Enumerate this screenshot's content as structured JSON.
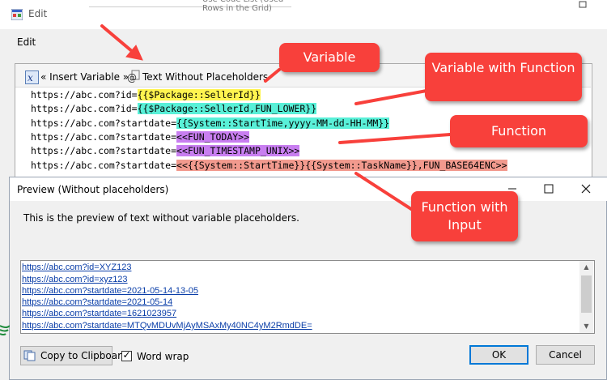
{
  "edit_window": {
    "title": "Edit",
    "label": "Edit",
    "background_title": "Use Code List (Used Rows in the Grid)"
  },
  "toolbar": {
    "insert_variable": "« Insert Variable »",
    "text_without_placeholders": "Text Without Placeholders"
  },
  "editor_lines": [
    {
      "prefix": "https://abc.com?id=",
      "highlight": "{{$Package::SellerId}}",
      "color": "#fff44f"
    },
    {
      "prefix": "https://abc.com?id=",
      "highlight": "{{$Package::SellerId,FUN_LOWER}}",
      "color": "#59f0d8"
    },
    {
      "prefix": "https://abc.com?startdate=",
      "highlight": "{{System::StartTime,yyyy-MM-dd-HH-MM}}",
      "color": "#59f0d8"
    },
    {
      "prefix": "https://abc.com?startdate=",
      "highlight": "<<FUN_TODAY>>",
      "color": "#c87ef0"
    },
    {
      "prefix": "https://abc.com?startdate=",
      "highlight": "<<FUN_TIMESTAMP_UNIX>>",
      "color": "#c87ef0"
    },
    {
      "prefix": "https://abc.com?startdate=",
      "highlight": "<<{{System::StartTime}}{{System::TaskName}},FUN_BASE64ENC>>",
      "color": "#f29a8e"
    }
  ],
  "preview": {
    "title": "Preview (Without placeholders)",
    "description": "This is the preview of text without variable placeholders.",
    "lines": [
      "https://abc.com?id=XYZ123",
      "https://abc.com?id=xyz123",
      "https://abc.com?startdate=2021-05-14-13-05",
      "https://abc.com?startdate=2021-05-14",
      "https://abc.com?startdate=1621023957",
      "https://abc.com?startdate=MTQvMDUvMjAyMSAxMy40NC4yM2RmdDE="
    ],
    "copy_button": "Copy to Clipboard",
    "word_wrap_label": "Word wrap",
    "word_wrap_checked": "✓",
    "ok_button": "OK",
    "cancel_button": "Cancel"
  },
  "callouts": {
    "variable": "Variable",
    "variable_with_function": "Variable with Function",
    "function": "Function",
    "function_with_input": "Function with Input"
  },
  "colors": {
    "callout": "#f8403b",
    "variable_highlight": "#fff44f",
    "function_var_highlight": "#59f0d8",
    "function_highlight": "#c87ef0",
    "function_input_highlight": "#f29a8e",
    "link": "#0a3ea8"
  },
  "icons": {
    "window_icon": "app-window-icon",
    "insert_variable": "insert-variable-icon",
    "text_without_placeholders": "at-document-icon",
    "copy": "copy-clipboard-icon",
    "minimize": "minimize-icon",
    "maximize": "maximize-icon",
    "close": "close-icon"
  }
}
